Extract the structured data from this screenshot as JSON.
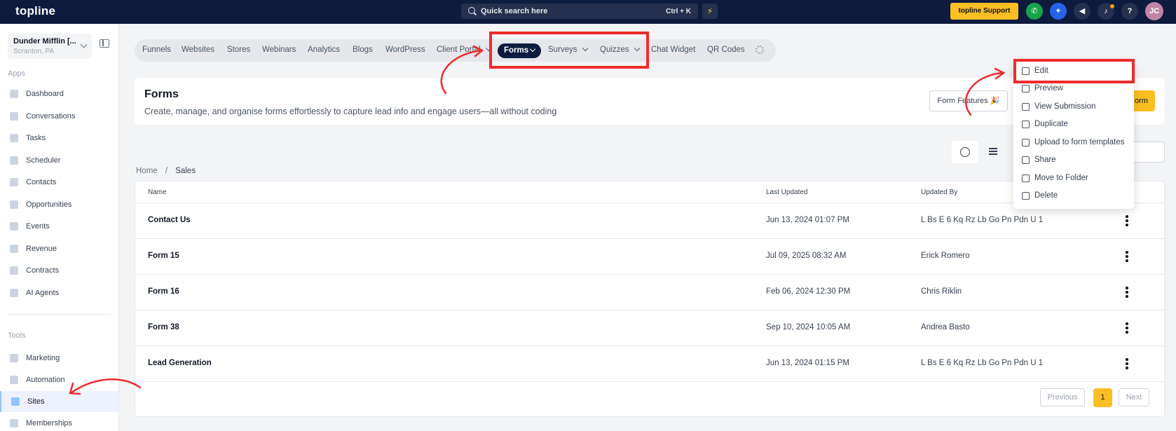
{
  "topbar": {
    "logo": "topline",
    "search_placeholder": "Quick search here",
    "search_shortcut": "Ctrl + K",
    "support_label": "topline Support",
    "help_label": "?",
    "avatar_initials": "JC"
  },
  "sidebar": {
    "account_name": "Dunder Mifflin [...",
    "account_location": "Scranton, PA",
    "apps_label": "Apps",
    "apps": [
      {
        "label": "Dashboard"
      },
      {
        "label": "Conversations"
      },
      {
        "label": "Tasks"
      },
      {
        "label": "Scheduler"
      },
      {
        "label": "Contacts"
      },
      {
        "label": "Opportunities"
      },
      {
        "label": "Events"
      },
      {
        "label": "Revenue"
      },
      {
        "label": "Contracts"
      },
      {
        "label": "AI Agents"
      }
    ],
    "tools_label": "Tools",
    "tools": [
      {
        "label": "Marketing"
      },
      {
        "label": "Automation"
      },
      {
        "label": "Sites",
        "active": true
      },
      {
        "label": "Memberships"
      }
    ]
  },
  "subnav": {
    "items": [
      {
        "label": "Funnels"
      },
      {
        "label": "Websites"
      },
      {
        "label": "Stores"
      },
      {
        "label": "Webinars"
      },
      {
        "label": "Analytics"
      },
      {
        "label": "Blogs"
      },
      {
        "label": "WordPress"
      },
      {
        "label": "Client Portal"
      },
      {
        "label": "Forms"
      },
      {
        "label": "Surveys"
      },
      {
        "label": "Quizzes"
      },
      {
        "label": "Chat Widget"
      },
      {
        "label": "QR Codes"
      }
    ]
  },
  "header": {
    "title": "Forms",
    "subtitle": "Create, manage, and organise forms effortlessly to capture lead info and engage users—all without coding",
    "features_button": "Form Features 🎉",
    "new_button": "orm"
  },
  "breadcrumb": {
    "home": "Home",
    "separator": "/",
    "current": "Sales"
  },
  "table": {
    "headers": {
      "name": "Name",
      "last_updated": "Last Updated",
      "updated_by": "Updated By"
    },
    "rows": [
      {
        "name": "Contact Us",
        "last_updated": "Jun 13, 2024 01:07 PM",
        "updated_by": "L Bs E 6 Kq Rz Lb Go Pn Pdn U 1"
      },
      {
        "name": "Form 15",
        "last_updated": "Jul 09, 2025 08:32 AM",
        "updated_by": "Erick Romero"
      },
      {
        "name": "Form 16",
        "last_updated": "Feb 06, 2024 12:30 PM",
        "updated_by": "Chris Riklin"
      },
      {
        "name": "Form 38",
        "last_updated": "Sep 10, 2024 10:05 AM",
        "updated_by": "Andrea Basto"
      },
      {
        "name": "Lead Generation",
        "last_updated": "Jun 13, 2024 01:15 PM",
        "updated_by": "L Bs E 6 Kq Rz Lb Go Pn Pdn U 1"
      }
    ]
  },
  "pagination": {
    "previous": "Previous",
    "current": "1",
    "next": "Next"
  },
  "context_menu": {
    "items": [
      {
        "label": "Edit",
        "icon": "pencil-icon"
      },
      {
        "label": "Preview",
        "icon": "external-link-icon"
      },
      {
        "label": "View Submission",
        "icon": "document-icon"
      },
      {
        "label": "Duplicate",
        "icon": "copy-icon"
      },
      {
        "label": "Upload to form templates",
        "icon": "upload-icon"
      },
      {
        "label": "Share",
        "icon": "share-icon"
      },
      {
        "label": "Move to Folder",
        "icon": "move-icon"
      },
      {
        "label": "Delete",
        "icon": "trash-icon"
      }
    ]
  },
  "colors": {
    "accent": "#fbbf24",
    "topbar": "#0d1b3f",
    "highlight": "#ef2b2b"
  }
}
